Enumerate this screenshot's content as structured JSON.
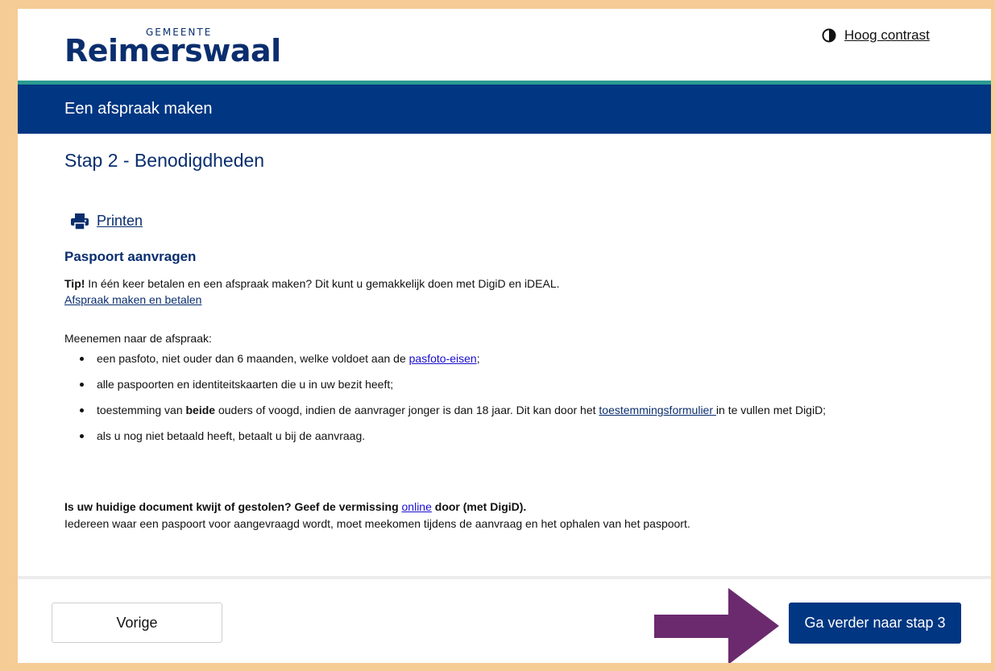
{
  "header": {
    "logo_small": "GEMEENTE",
    "logo_big": "Reimerswaal",
    "contrast_link": "Hoog contrast"
  },
  "banner": {
    "title": "Een afspraak maken"
  },
  "step": {
    "title": "Stap 2 - Benodigdheden"
  },
  "print": {
    "label": "Printen"
  },
  "section": {
    "title": "Paspoort aanvragen",
    "tip_bold": "Tip!",
    "tip_text": "In één keer betalen en een afspraak maken? Dit kunt u gemakkelijk doen met DigiD en iDEAL.",
    "tip_link": "Afspraak maken en betalen ",
    "intro": "Meenemen naar de afspraak:",
    "items": [
      {
        "before": "een pasfoto, niet ouder dan 6 maanden, welke voldoet aan de ",
        "link": "pasfoto-eisen",
        "after": ";"
      },
      {
        "text": "alle paspoorten en identiteitskaarten die u in uw bezit heeft;"
      },
      {
        "before": "toestemming van ",
        "bold": "beide",
        "middle": " ouders of voogd, indien de aanvrager jonger is dan 18 jaar. Dit kan door het ",
        "link": "toestemmingsformulier ",
        "after": "in te vullen met DigiD;"
      },
      {
        "text": "als u nog niet betaald heeft, betaalt u bij de aanvraag."
      }
    ],
    "lost_bold_before": "Is uw huidige document kwijt of gestolen? Geef de vermissing ",
    "lost_link": "online",
    "lost_bold_after": " door (met DigiD).",
    "lost_text": "Iedereen waar een paspoort voor aangevraagd wordt, moet meekomen tijdens de aanvraag en het ophalen van het paspoort."
  },
  "footer": {
    "prev_label": "Vorige",
    "next_label": "Ga verder naar stap 3"
  },
  "colors": {
    "brand_navy": "#003682",
    "accent_teal": "#2a9c90",
    "arrow_purple": "#6b2a6e",
    "page_border": "#f5cc96"
  }
}
